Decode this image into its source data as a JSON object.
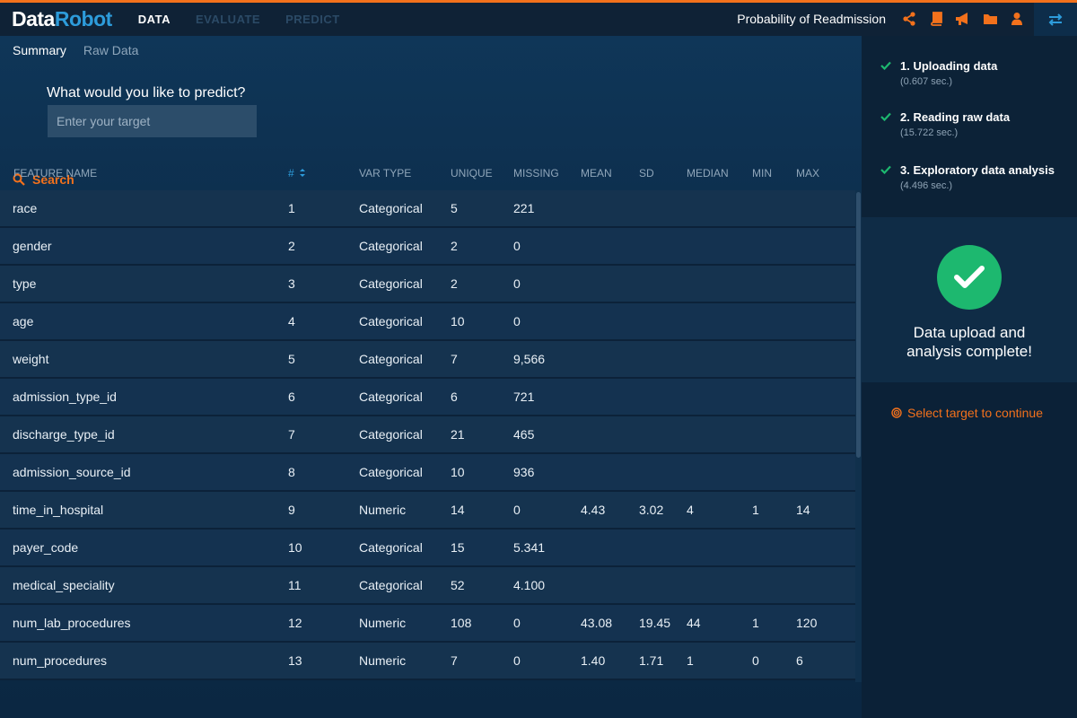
{
  "header": {
    "logo": {
      "part1": "Data",
      "part2": "Robot"
    },
    "tabs": [
      {
        "label": "DATA"
      },
      {
        "label": "EVALUATE"
      },
      {
        "label": "PREDICT"
      }
    ],
    "project_name": "Probability of Readmission",
    "icons": [
      "share-icon",
      "book-icon",
      "megaphone-icon",
      "folder-icon",
      "user-icon",
      "swap-icon"
    ],
    "accent_color": "#f2711c"
  },
  "subtabs": [
    {
      "label": "Summary"
    },
    {
      "label": "Raw Data"
    }
  ],
  "target": {
    "question": "What would you like to predict?",
    "placeholder": "Enter your target"
  },
  "search": {
    "label": "Search"
  },
  "table": {
    "columns": [
      "FEATURE NAME",
      "#",
      "VAR TYPE",
      "UNIQUE",
      "MISSING",
      "MEAN",
      "SD",
      "MEDIAN",
      "MIN",
      "MAX"
    ],
    "rows": [
      [
        "race",
        "1",
        "Categorical",
        "5",
        "221",
        "",
        "",
        "",
        "",
        ""
      ],
      [
        "gender",
        "2",
        "Categorical",
        "2",
        "0",
        "",
        "",
        "",
        "",
        ""
      ],
      [
        "type",
        "3",
        "Categorical",
        "2",
        "0",
        "",
        "",
        "",
        "",
        ""
      ],
      [
        "age",
        "4",
        "Categorical",
        "10",
        "0",
        "",
        "",
        "",
        "",
        ""
      ],
      [
        "weight",
        "5",
        "Categorical",
        "7",
        "9,566",
        "",
        "",
        "",
        "",
        ""
      ],
      [
        "admission_type_id",
        "6",
        "Categorical",
        "6",
        "721",
        "",
        "",
        "",
        "",
        ""
      ],
      [
        "discharge_type_id",
        "7",
        "Categorical",
        "21",
        "465",
        "",
        "",
        "",
        "",
        ""
      ],
      [
        "admission_source_id",
        "8",
        "Categorical",
        "10",
        "936",
        "",
        "",
        "",
        "",
        ""
      ],
      [
        "time_in_hospital",
        "9",
        "Numeric",
        "14",
        "0",
        "4.43",
        "3.02",
        "4",
        "1",
        "14"
      ],
      [
        "payer_code",
        "10",
        "Categorical",
        "15",
        "5.341",
        "",
        "",
        "",
        "",
        ""
      ],
      [
        "medical_speciality",
        "11",
        "Categorical",
        "52",
        "4.100",
        "",
        "",
        "",
        "",
        ""
      ],
      [
        "num_lab_procedures",
        "12",
        "Numeric",
        "108",
        "0",
        "43.08",
        "19.45",
        "44",
        "1",
        "120"
      ],
      [
        "num_procedures",
        "13",
        "Numeric",
        "7",
        "0",
        "1.40",
        "1.71",
        "1",
        "0",
        "6"
      ]
    ]
  },
  "progress": {
    "steps": [
      {
        "title": "1. Uploading data",
        "time": "(0.607 sec.)"
      },
      {
        "title": "2. Reading raw data",
        "time": "(15.722 sec.)"
      },
      {
        "title": "3. Exploratory data analysis",
        "time": "(4.496 sec.)"
      }
    ],
    "complete_line1": "Data upload and",
    "complete_line2": "analysis complete!",
    "cta": "Select target to continue",
    "success_color": "#1db86f"
  }
}
